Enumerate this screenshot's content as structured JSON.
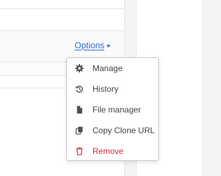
{
  "options_link": {
    "label": "Options"
  },
  "menu": {
    "items": [
      {
        "label": "Manage",
        "icon": "gear-icon"
      },
      {
        "label": "History",
        "icon": "history-icon"
      },
      {
        "label": "File manager",
        "icon": "file-icon"
      },
      {
        "label": "Copy Clone URL",
        "icon": "copy-icon"
      },
      {
        "label": "Remove",
        "icon": "trash-icon"
      }
    ]
  },
  "colors": {
    "link": "#2f6fd3",
    "danger": "#d6283b",
    "menu_text": "#3f4348",
    "icon": "#4a4f55"
  }
}
